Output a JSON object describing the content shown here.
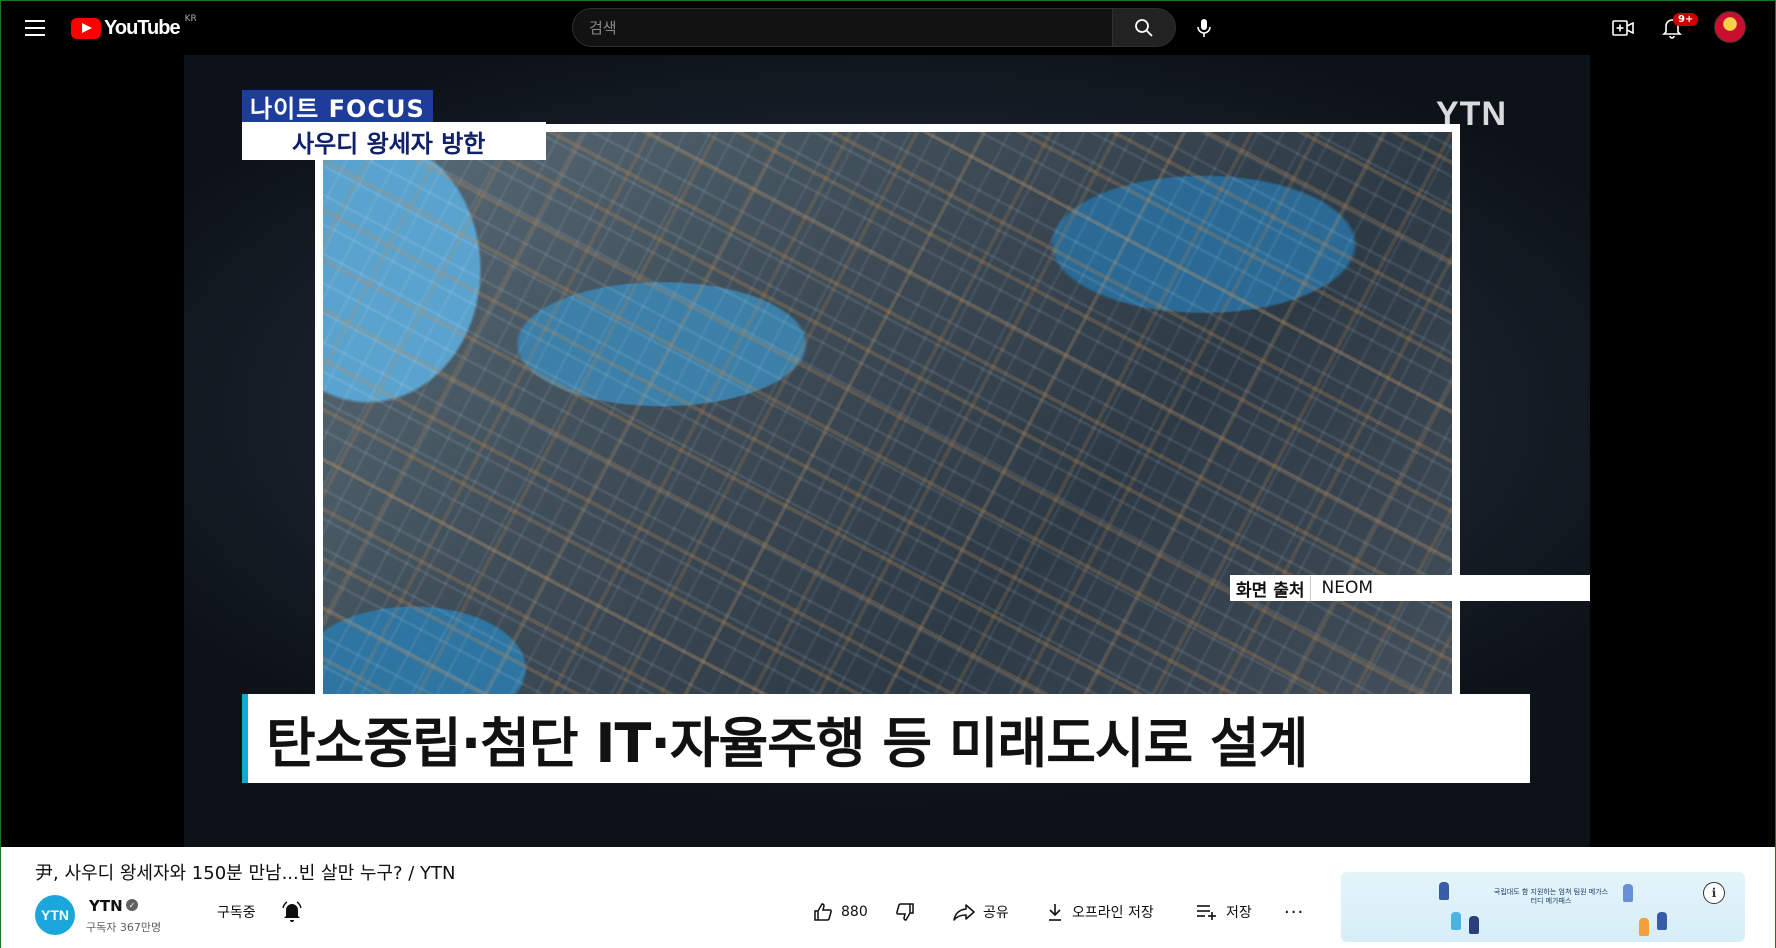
{
  "header": {
    "logo_text": "YouTube",
    "country_code": "KR",
    "search_placeholder": "검색",
    "notification_count": "9+"
  },
  "video": {
    "program_logo": "나이트 FOCUS",
    "program_subtitle": "사우디 왕세자 방한",
    "broadcaster_watermark": "YTN",
    "source_label": "화면 출처",
    "source_value": "NEOM",
    "headline": "탄소중립·첨단 IT·자율주행 등 미래도시로 설계"
  },
  "info": {
    "title": "尹, 사우디 왕세자와 150분 만남...빈 살만 누구? / YTN",
    "channel_avatar_text": "YTN",
    "channel_name": "YTN",
    "subscriber_count": "구독자 367만명",
    "subscribe_status": "구독중",
    "like_count": "880",
    "share_label": "공유",
    "offline_label": "오프라인 저장",
    "save_label": "저장",
    "more_label": "···"
  },
  "ad": {
    "text": "국립대도 함 지원하는 엄쳐 팀원 메가스터디 메가패스"
  },
  "colors": {
    "accent_red": "#ff0000",
    "ytn_blue": "#1ba7dc",
    "focus_navy": "#1e3c9a"
  }
}
